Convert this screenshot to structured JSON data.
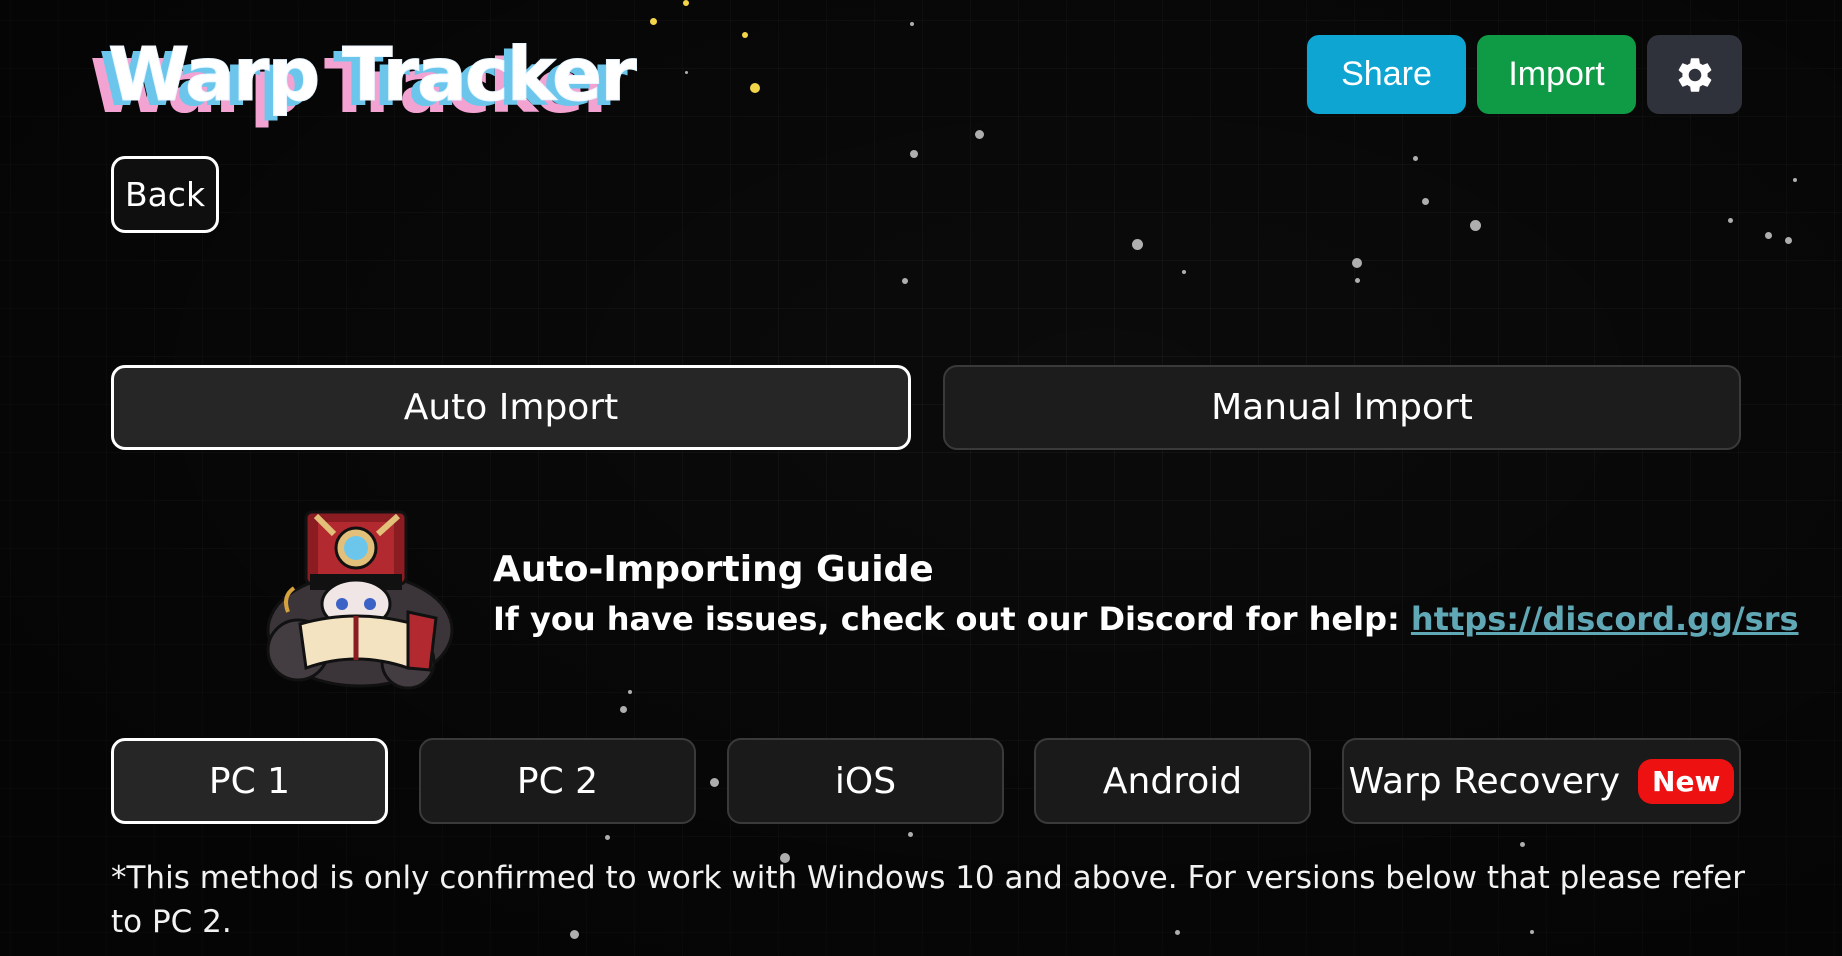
{
  "logo": {
    "text": "Warp Tracker"
  },
  "header": {
    "share_label": "Share",
    "import_label": "Import",
    "settings_icon": "gear-icon",
    "back_label": "Back"
  },
  "import_tabs": [
    {
      "label": "Auto Import",
      "active": true
    },
    {
      "label": "Manual Import",
      "active": false
    }
  ],
  "guide": {
    "title": "Auto-Importing Guide",
    "help_text": "If you have issues, check out our Discord for help: ",
    "link_text": "https://discord.gg/srs"
  },
  "platforms": [
    {
      "label": "PC 1",
      "active": true
    },
    {
      "label": "PC 2",
      "active": false
    },
    {
      "label": "iOS",
      "active": false
    },
    {
      "label": "Android",
      "active": false
    },
    {
      "label": "Warp Recovery",
      "active": false,
      "badge": "New"
    }
  ],
  "note": "*This method is only confirmed to work with Windows 10 and above. For versions below that please refer to PC 2.",
  "colors": {
    "share": "#0ea5d2",
    "import": "#0f9b45",
    "settings": "#2f323b",
    "link": "#61a8b7",
    "badge": "#ee1111"
  }
}
